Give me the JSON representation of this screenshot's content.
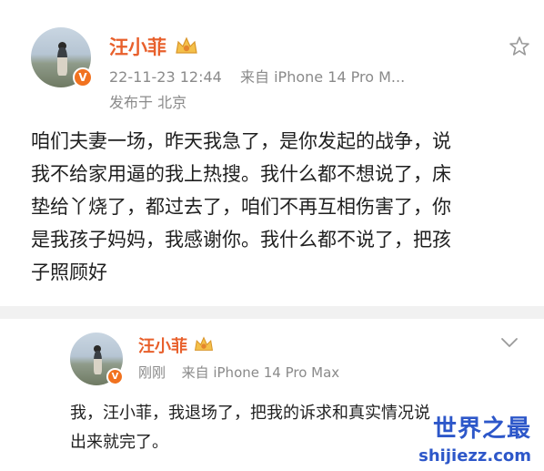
{
  "post1": {
    "author": "汪小菲",
    "timestamp": "22-11-23 12:44",
    "source": "来自 iPhone 14 Pro M...",
    "location": "发布于 北京",
    "content": "咱们夫妻一场，昨天我急了，是你发起的战争，说\n我不给家用逼的我上热搜。我什么都不想说了，床\n垫给丫烧了，都过去了，咱们不再互相伤害了，你\n是我孩子妈妈，我感谢你。我什么都不说了，把孩\n子照顾好",
    "verified_badge": "V",
    "icons": [
      "star-icon",
      "crown-icon"
    ]
  },
  "post2": {
    "author": "汪小菲",
    "timestamp": "刚刚",
    "source": "来自 iPhone 14 Pro Max",
    "content": "我，汪小菲，我退场了，把我的诉求和真实情况说\n出来就完了。",
    "verified_badge": "V",
    "icons": [
      "chevron-down-icon",
      "crown-icon"
    ]
  },
  "watermark": {
    "title": "世界之最",
    "site": "shijiezz.com"
  },
  "colors": {
    "name": "#e8602c",
    "meta": "#8a8a8a",
    "badge": "#f1721f",
    "watermark": "#2d57c9"
  }
}
